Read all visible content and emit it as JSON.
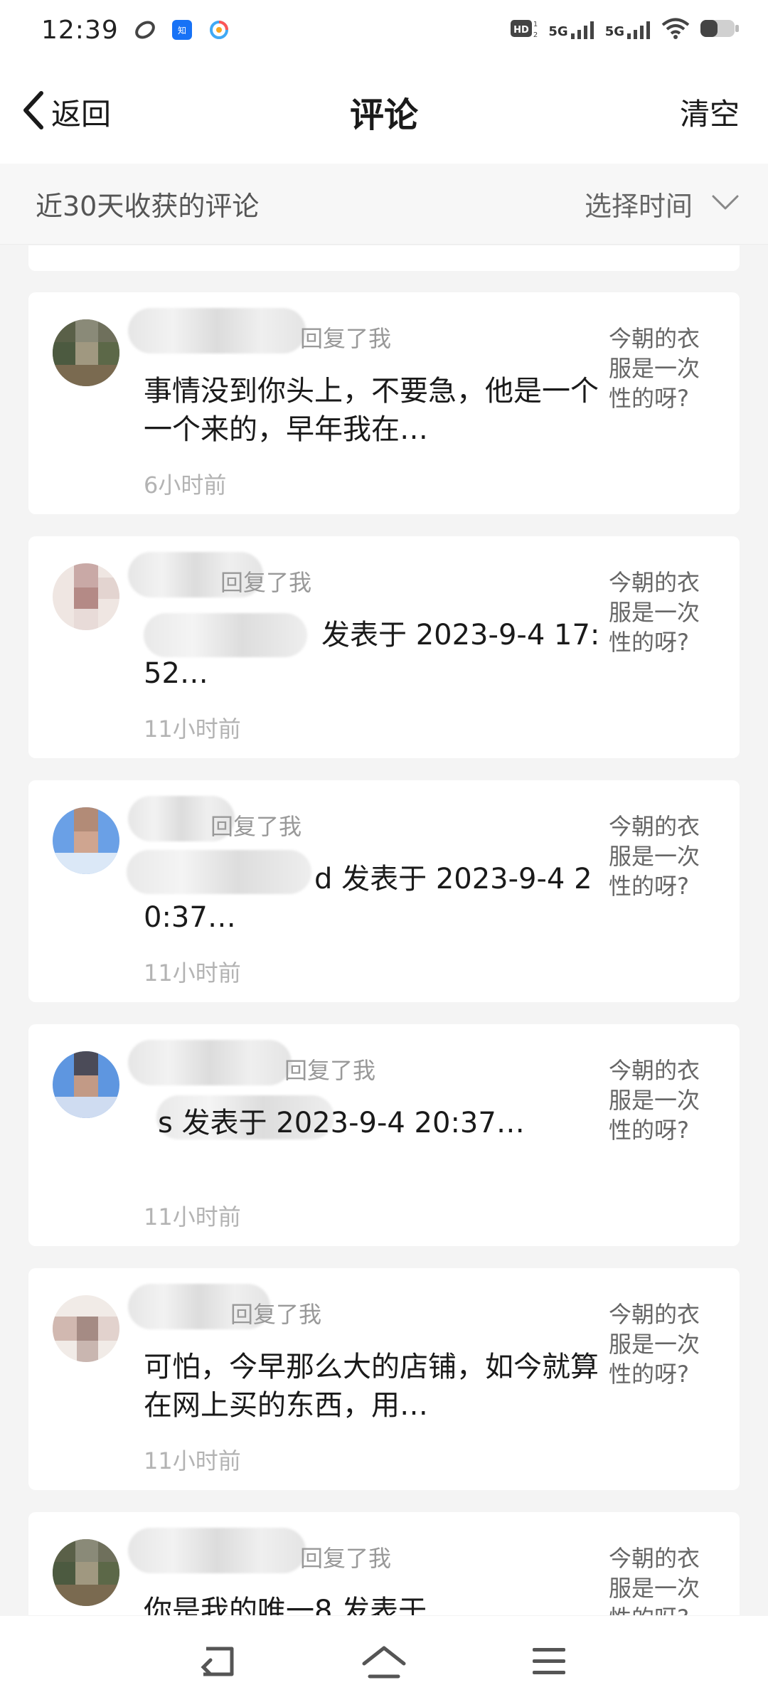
{
  "status_bar": {
    "time": "12:39",
    "notification_icons": [
      "link-icon",
      "zhihu-icon",
      "color-circle-icon"
    ],
    "network_label_1": "5G",
    "network_label_2": "5G",
    "hd_label": "HD"
  },
  "nav": {
    "back_label": "返回",
    "title": "评论",
    "action_label": "清空"
  },
  "filter": {
    "label": "近30天收获的评论",
    "select_label": "选择时间"
  },
  "comments": [
    {
      "reply_label": "回复了我",
      "text": "事情没到你头上，不要急，他是一个一个来的，早年我在…",
      "time": "6小时前",
      "origin": "今朝的衣服是一次性的呀?"
    },
    {
      "reply_label": "回复了我",
      "text": "发表于 2023-9-4 17:52…",
      "time": "11小时前",
      "origin": "今朝的衣服是一次性的呀?"
    },
    {
      "reply_label": "回复了我",
      "text": "d 发表于 2023-9-4 20:37…",
      "time": "11小时前",
      "origin": "今朝的衣服是一次性的呀?"
    },
    {
      "reply_label": "回复了我",
      "text": "s 发表于 2023-9-4 20:37…",
      "time": "11小时前",
      "origin": "今朝的衣服是一次性的呀?"
    },
    {
      "reply_label": "回复了我",
      "text": "可怕，今早那么大的店铺，如今就算在网上买的东西，用…",
      "time": "11小时前",
      "origin": "今朝的衣服是一次性的呀?"
    },
    {
      "reply_label": "回复了我",
      "text": "你是我的唯一8 发表于",
      "time": "",
      "origin": "今朝的衣服是一次性的呀?"
    }
  ],
  "bottom_nav": {
    "icons": [
      "back-nav-icon",
      "home-nav-icon",
      "menu-nav-icon"
    ]
  }
}
